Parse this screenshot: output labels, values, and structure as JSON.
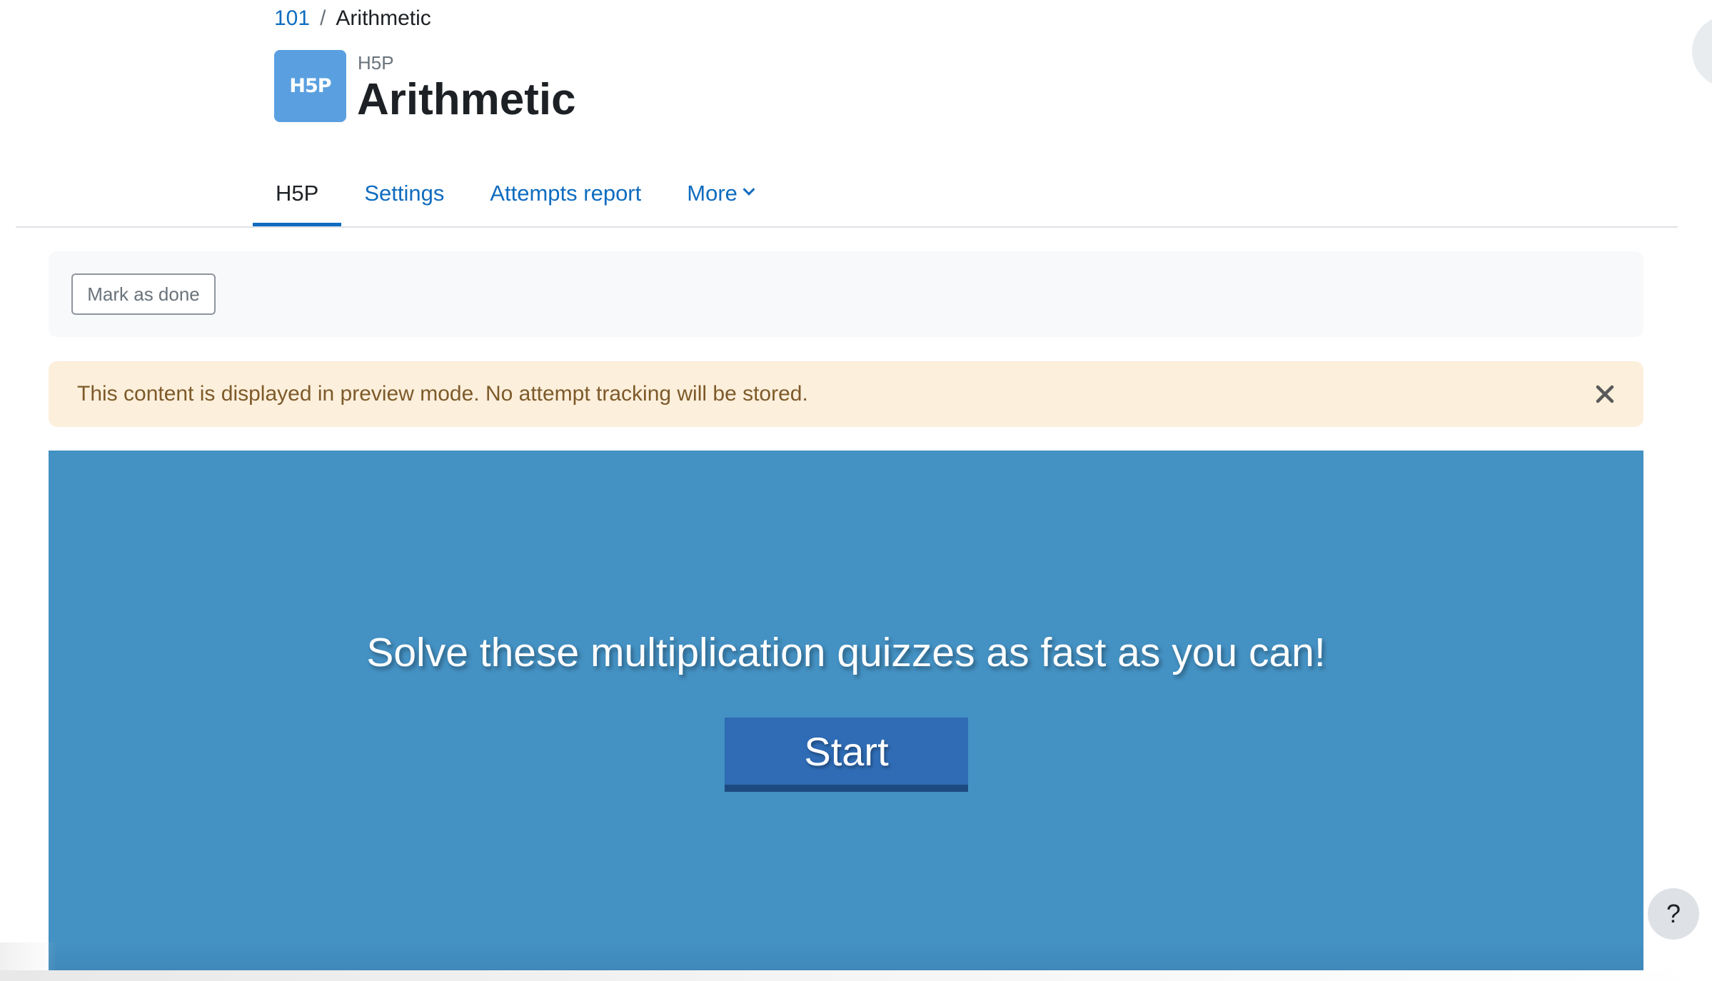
{
  "breadcrumb": {
    "course": "101",
    "separator": "/",
    "current": "Arithmetic"
  },
  "header": {
    "icon_text": "H5P",
    "activity_type": "H5P",
    "title": "Arithmetic"
  },
  "tabs": [
    {
      "label": "H5P",
      "active": true
    },
    {
      "label": "Settings",
      "active": false
    },
    {
      "label": "Attempts report",
      "active": false
    },
    {
      "label": "More",
      "active": false
    }
  ],
  "completion": {
    "mark_done_label": "Mark as done"
  },
  "alert": {
    "message": "This content is displayed in preview mode. No attempt tracking will be stored."
  },
  "h5p": {
    "intro": "Solve these multiplication quizzes as fast as you can!",
    "start_label": "Start"
  },
  "help": {
    "label": "?"
  },
  "colors": {
    "link": "#0f6cbf",
    "h5p_background": "#4491c3",
    "start_button": "#2f6cb5",
    "alert_background": "#fcefdc"
  }
}
